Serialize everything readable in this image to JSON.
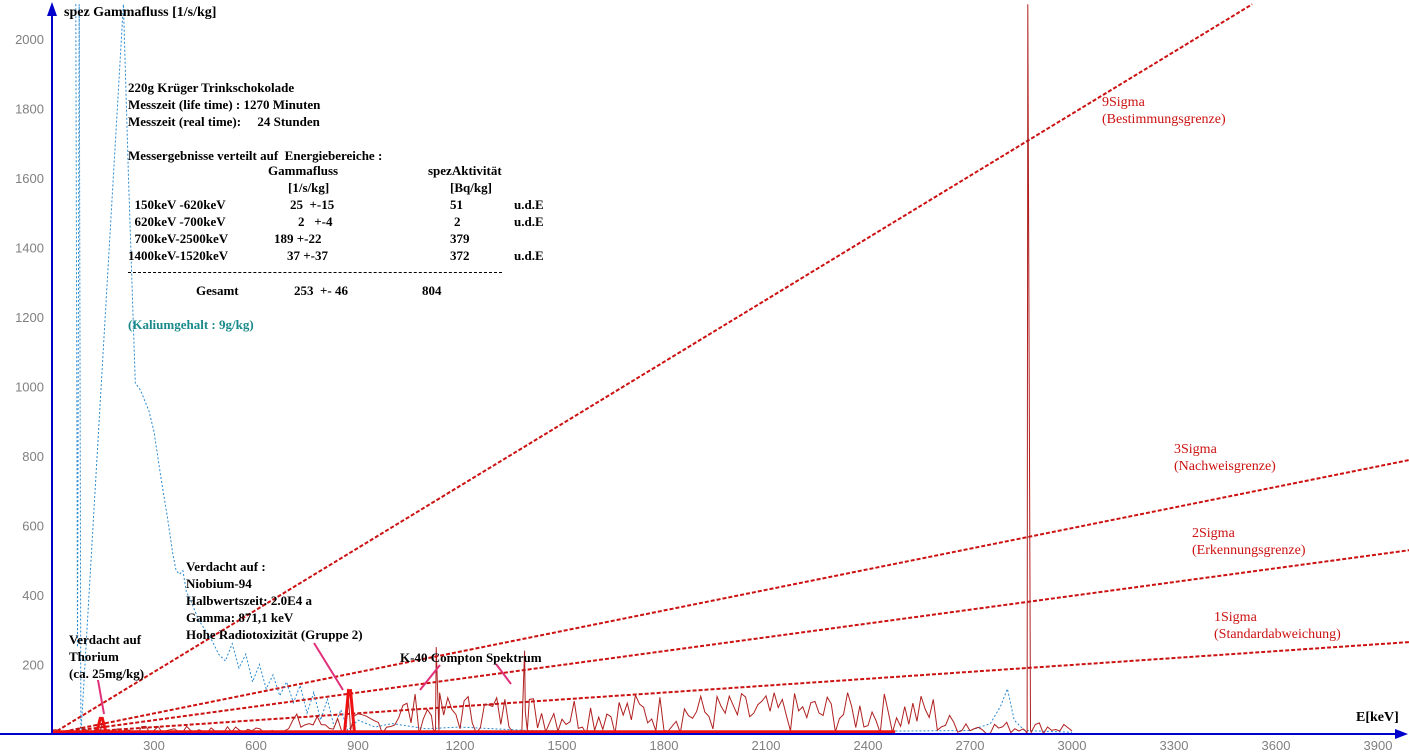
{
  "chart_data": {
    "type": "line",
    "ylabel": "spez Gammafluss [1/s/kg]",
    "xlabel": "E[keV]",
    "xlim": [
      0,
      4000
    ],
    "ylim": [
      0,
      2100
    ],
    "x_ticks": [
      300,
      600,
      900,
      1200,
      1500,
      1800,
      2100,
      2400,
      2700,
      3000,
      3300,
      3600,
      3900
    ],
    "y_ticks": [
      200,
      400,
      600,
      800,
      1000,
      1200,
      1400,
      1600,
      1800,
      2000
    ],
    "colors": {
      "spectrum": "#b02020",
      "background": "#2a8ad0",
      "sigma": "#cc1111",
      "axis": "#0000cc",
      "annotation": "#e0307a",
      "band": "#ee1111"
    },
    "spectrum_peaks": [
      {
        "x": 2870,
        "y": 2100
      },
      {
        "x": 1130,
        "y": 250
      },
      {
        "x": 1390,
        "y": 240
      },
      {
        "x": 870,
        "y": 130
      },
      {
        "x": 150,
        "y": 40
      }
    ],
    "background_series": [
      [
        70,
        2100
      ],
      [
        75,
        250
      ],
      [
        80,
        2100
      ],
      [
        85,
        0
      ],
      [
        210,
        2100
      ],
      [
        225,
        1600
      ],
      [
        245,
        1010
      ],
      [
        260,
        990
      ],
      [
        285,
        930
      ],
      [
        300,
        870
      ],
      [
        320,
        740
      ],
      [
        340,
        620
      ],
      [
        355,
        520
      ],
      [
        365,
        470
      ],
      [
        375,
        460
      ],
      [
        385,
        470
      ],
      [
        395,
        410
      ],
      [
        410,
        380
      ],
      [
        430,
        330
      ],
      [
        450,
        300
      ],
      [
        470,
        270
      ],
      [
        490,
        230
      ],
      [
        510,
        210
      ],
      [
        530,
        260
      ],
      [
        550,
        190
      ],
      [
        570,
        230
      ],
      [
        590,
        150
      ],
      [
        610,
        200
      ],
      [
        630,
        130
      ],
      [
        650,
        170
      ],
      [
        670,
        110
      ],
      [
        690,
        150
      ],
      [
        710,
        90
      ],
      [
        730,
        140
      ],
      [
        750,
        60
      ],
      [
        770,
        120
      ],
      [
        790,
        40
      ],
      [
        810,
        100
      ],
      [
        830,
        20
      ],
      [
        850,
        70
      ],
      [
        870,
        10
      ],
      [
        900,
        40
      ],
      [
        950,
        20
      ],
      [
        1000,
        30
      ],
      [
        1100,
        15
      ],
      [
        1200,
        20
      ],
      [
        1400,
        10
      ],
      [
        1800,
        8
      ],
      [
        2400,
        8
      ],
      [
        2700,
        10
      ],
      [
        2760,
        30
      ],
      [
        2790,
        80
      ],
      [
        2810,
        130
      ],
      [
        2830,
        40
      ],
      [
        2860,
        10
      ],
      [
        3000,
        5
      ]
    ],
    "sigma_lines": [
      {
        "name": "9Sigma",
        "label_lines": [
          "9Sigma",
          "(Bestimmungsgrenze)"
        ],
        "x0": 0,
        "y0": 0,
        "x1": 3530,
        "y1": 2100
      },
      {
        "name": "3Sigma",
        "label_lines": [
          "3Sigma",
          "(Nachweisgrenze)"
        ],
        "x0": 0,
        "y0": 0,
        "x1": 4000,
        "y1": 790
      },
      {
        "name": "2Sigma",
        "label_lines": [
          "2Sigma",
          "(Erkennungsgrenze)"
        ],
        "x0": 0,
        "y0": 0,
        "x1": 4000,
        "y1": 530
      },
      {
        "name": "1Sigma",
        "label_lines": [
          "1Sigma",
          "(Standardabweichung)"
        ],
        "x0": 0,
        "y0": 0,
        "x1": 4000,
        "y1": 265
      }
    ],
    "red_bands": [
      {
        "x": [
          0,
          2480
        ],
        "y": 5
      },
      {
        "x": [
          130,
          160
        ],
        "y": 45
      },
      {
        "x": [
          860,
          890
        ],
        "y": 125
      }
    ]
  },
  "info": {
    "sample": "220g Krüger Trinkschokolade",
    "life_time": "Messzeit (life time) : 1270 Minuten",
    "real_time": "Messzeit (real time):     24 Stunden",
    "results_heading": "Messergebnisse verteilt auf  Energiebereiche :",
    "col1_header": "Gammafluss",
    "col1_unit": "[1/s/kg]",
    "col2_header": "spezAktivität",
    "col2_unit": "[Bq/kg]",
    "rows": [
      {
        "range": "  150keV -620keV",
        "flux": "25  +-15",
        "activity": "51",
        "note": "u.d.E"
      },
      {
        "range": "  620keV -700keV",
        "flux": "2   +-4",
        "activity": "2",
        "note": "u.d.E"
      },
      {
        "range": "  700keV-2500keV",
        "flux": "189 +-22",
        "activity": "379",
        "note": ""
      },
      {
        "range": "1400keV-1520keV",
        "flux": "    37 +-37",
        "activity": "372",
        "note": "u.d.E"
      }
    ],
    "total_label": "Gesamt",
    "total_flux": "253  +- 46",
    "total_activity": "804",
    "potassium": "(Kaliumgehalt : 9g/kg)"
  },
  "annotations": {
    "niobium": [
      "Verdacht auf :",
      "Niobium-94",
      "Halbwertszeit: 2.0E4 a",
      "Gamma: 871,1 keV",
      "Hohe Radiotoxizität (Gruppe 2)"
    ],
    "thorium": [
      "Verdacht auf",
      "Thorium",
      "(ca. 25mg/kg)"
    ],
    "k40": "K-40 Compton Spektrum"
  }
}
